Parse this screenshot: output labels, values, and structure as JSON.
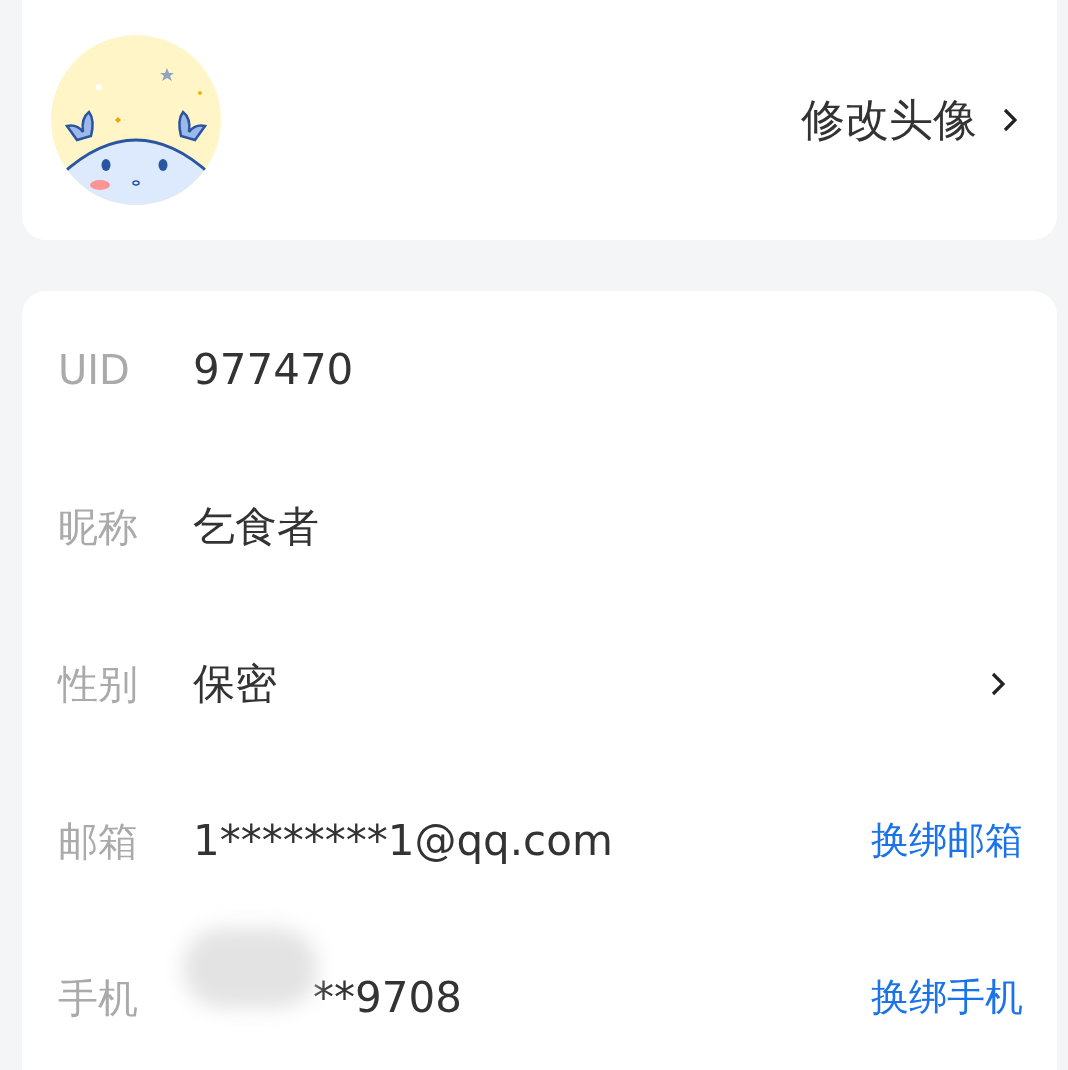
{
  "avatar_card": {
    "action": "修改头像"
  },
  "fields": [
    {
      "label": "UID",
      "value": "977470",
      "kind": "plain"
    },
    {
      "label": "昵称",
      "value": "乞食者",
      "kind": "plain"
    },
    {
      "label": "性别",
      "value": "保密",
      "kind": "chevron"
    },
    {
      "label": "邮箱",
      "value": "1********1@qq.com",
      "kind": "link",
      "action": "换绑邮箱"
    },
    {
      "label": "手机",
      "value": "**9708",
      "kind": "redacted-link",
      "action": "换绑手机"
    }
  ]
}
